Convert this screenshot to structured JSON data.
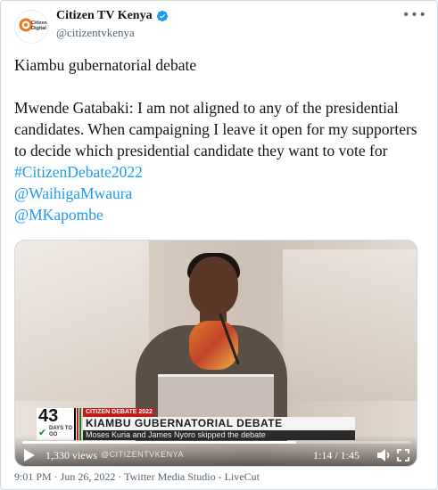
{
  "author": {
    "display_name": "Citizen TV Kenya",
    "handle": "@citizentvkenya",
    "avatar_text": "Citizen Digital",
    "verified": true
  },
  "tweet": {
    "line1": "Kiambu gubernatorial debate",
    "line2": "Mwende Gatabaki: I am not aligned to any of the presidential candidates. When campaigning I leave it open for my supporters to decide which presidential candidate they want to vote for",
    "hashtag": "#CitizenDebate2022",
    "mention1": "@WaihigaMwaura",
    "mention2": "@MKapombe"
  },
  "video": {
    "lower_third": {
      "countdown_number": "43",
      "countdown_sub": "DAYS TO GO",
      "tag": "CITIZEN DEBATE 2022",
      "title": "KIAMBU GUBERNATORIAL DEBATE",
      "ticker": "Moses Kuria and James Nyoro skipped the debate"
    },
    "views": "1,330 views",
    "watermark": "@CITIZENTVKENYA",
    "time": "1:14 / 1:45",
    "progress": 0.705
  },
  "meta_line": "9:01 PM · Jun 26, 2022 · Twitter Media Studio - LiveCut",
  "colors": {
    "link": "#1d9bf0",
    "secondary_text": "#536471",
    "verified": "#1d9bf0"
  }
}
